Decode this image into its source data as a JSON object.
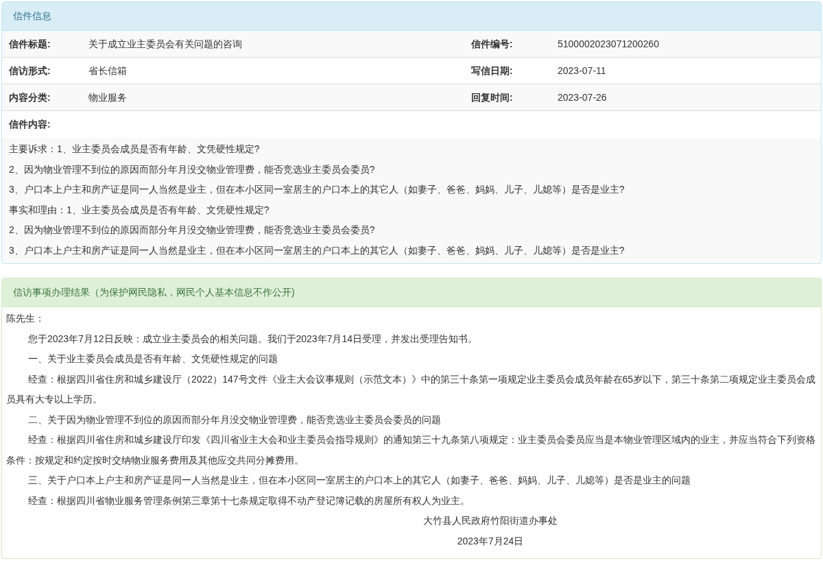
{
  "letter_panel": {
    "title": "信件信息",
    "rows": [
      {
        "label": "信件标题:",
        "value": "关于成立业主委员会有关问题的咨询",
        "label_2": "信件编号:",
        "value_2": "5100002023071200260"
      },
      {
        "label": "信访形式:",
        "value": "省长信箱",
        "label_2": "写信日期:",
        "value_2": "2023-07-11"
      },
      {
        "label": "内容分类:",
        "value": "物业服务",
        "label_2": "回复时间:",
        "value_2": "2023-07-26"
      }
    ],
    "content_label": "信件内容:",
    "content_lines": [
      "主要诉求：1、业主委员会成员是否有年龄、文凭硬性规定?",
      "2、因为物业管理不到位的原因而部分年月没交物业管理费，能否竞选业主委员会委员?",
      "3、户口本上户主和房产证是同一人当然是业主，但在本小区同一室居主的户口本上的其它人（如妻子、爸爸、妈妈、儿子、儿媳等）是否是业主?",
      "事实和理由：1、业主委员会成员是否有年龄、文凭硬性规定?",
      "2、因为物业管理不到位的原因而部分年月没交物业管理费，能否竞选业主委员会委员?",
      "3、户口本上户主和房产证是同一人当然是业主，但在本小区同一室居主的户口本上的其它人（如妻子、爸爸、妈妈、儿子、儿媳等）是否是业主?"
    ]
  },
  "result_panel": {
    "title": "信访事项办理结果（为保护网民隐私，网民个人基本信息不作公开)",
    "paragraphs": [
      {
        "kind": "salutation",
        "text": "陈先生："
      },
      {
        "kind": "body",
        "text": "您于2023年7月12日反映：成立业主委员会的相关问题。我们于2023年7月14日受理，并发出受理告知书。"
      },
      {
        "kind": "body",
        "text": "一、关于业主委员会成员是否有年龄、文凭硬性规定的问题"
      },
      {
        "kind": "body",
        "text": "经查：根据四川省住房和城乡建设厅（2022）147号文件《业主大会议事规则（示范文本）》中的第三十条第一项规定业主委员会成员年龄在65岁以下，第三十条第二项规定业主委员会成员具有大专以上学历。"
      },
      {
        "kind": "body",
        "text": "二、关于因为物业管理不到位的原因而部分年月没交物业管理费，能否竞选业主委员会委员的问题"
      },
      {
        "kind": "body",
        "text": "经查：根据四川省住房和城乡建设厅印发《四川省业主大会和业主委员会指导规则》的通知第三十九条第八项规定：业主委员会委员应当是本物业管理区域内的业主，并应当符合下列资格条件：按规定和约定按时交纳物业服务费用及其他应交共同分摊费用。"
      },
      {
        "kind": "body",
        "text": "三、关于户口本上户主和房产证是同一人当然是业主，但在本小区同一室居主的户口本上的其它人（如妻子、爸爸、妈妈、儿子、儿媳等）是否是业主的问题"
      },
      {
        "kind": "body",
        "text": "经查：根据四川省物业服务管理条例第三章第十七条规定取得不动产登记簿记载的房屋所有权人为业主。"
      },
      {
        "kind": "signature",
        "text": "大竹县人民政府竹阳街道办事处"
      },
      {
        "kind": "signature",
        "text": "2023年7月24日"
      }
    ]
  }
}
